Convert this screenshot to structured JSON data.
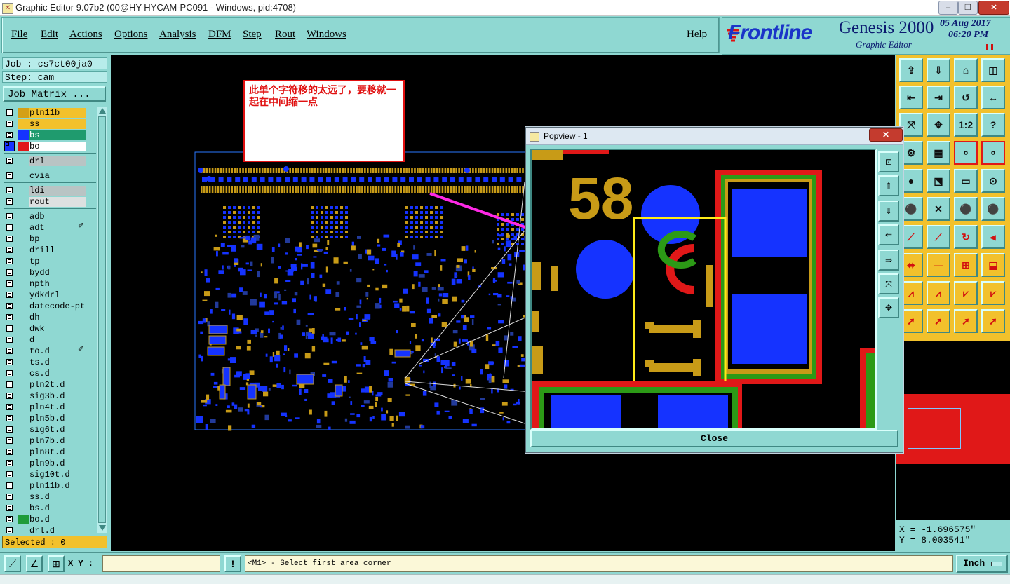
{
  "window": {
    "title": "Graphic Editor 9.07b2 (00@HY-HYCAM-PC091 - Windows, pid:4708)",
    "buttons": {
      "minimize": "–",
      "restore": "❐",
      "close": "✕"
    }
  },
  "menubar": {
    "items": [
      "File",
      "Edit",
      "Actions",
      "Options",
      "Analysis",
      "DFM",
      "Step",
      "Rout",
      "Windows"
    ],
    "help": "Help"
  },
  "logo": {
    "brand": "Frontline",
    "product": "Genesis 2000",
    "subtitle": "Graphic Editor",
    "date": "05 Aug 2017",
    "time": "06:20 PM"
  },
  "job": {
    "job_label": "Job : cs7ct00ja0",
    "step_label": "Step: cam",
    "matrix_button": "Job Matrix ..."
  },
  "layers": [
    {
      "name": "pln11b",
      "color": "#d4a017",
      "nameBg": "#f2c12c",
      "group": 0
    },
    {
      "name": "ss",
      "color": "#f2c12c",
      "nameBg": "#f2c12c",
      "group": 0
    },
    {
      "name": "bs",
      "color": "#1533ff",
      "nameBg": "#1f9b6e",
      "group": 0
    },
    {
      "name": "bo",
      "color": "#e01818",
      "nameBg": "#ffffff",
      "group": 0,
      "chkBlue": true
    },
    {
      "name": "drl",
      "color": "",
      "nameBg": "#b9c4c4",
      "group": 1
    },
    {
      "name": "cvia",
      "color": "",
      "nameBg": "#8fd8d2",
      "group": 2
    },
    {
      "name": "ldi",
      "color": "",
      "nameBg": "#b9c4c4",
      "group": 3
    },
    {
      "name": "rout",
      "color": "",
      "nameBg": "#dde0e0",
      "group": 3
    },
    {
      "name": "adb",
      "color": "",
      "nameBg": "#8fd8d2",
      "group": 4
    },
    {
      "name": "adt",
      "color": "",
      "nameBg": "#8fd8d2",
      "group": 4,
      "mark": true
    },
    {
      "name": "bp",
      "color": "",
      "nameBg": "#8fd8d2",
      "group": 4
    },
    {
      "name": "drill",
      "color": "",
      "nameBg": "#8fd8d2",
      "group": 4
    },
    {
      "name": "tp",
      "color": "",
      "nameBg": "#8fd8d2",
      "group": 4
    },
    {
      "name": "bydd",
      "color": "",
      "nameBg": "#8fd8d2",
      "group": 4
    },
    {
      "name": "npth",
      "color": "",
      "nameBg": "#8fd8d2",
      "group": 4
    },
    {
      "name": "ydkdrl",
      "color": "",
      "nameBg": "#8fd8d2",
      "group": 4
    },
    {
      "name": "datecode-ptd",
      "color": "",
      "nameBg": "#8fd8d2",
      "group": 4
    },
    {
      "name": "dh",
      "color": "",
      "nameBg": "#8fd8d2",
      "group": 4
    },
    {
      "name": "dwk",
      "color": "",
      "nameBg": "#8fd8d2",
      "group": 4
    },
    {
      "name": "d",
      "color": "",
      "nameBg": "#8fd8d2",
      "group": 4
    },
    {
      "name": "to.d",
      "color": "",
      "nameBg": "#8fd8d2",
      "group": 4,
      "mark": true
    },
    {
      "name": "ts.d",
      "color": "",
      "nameBg": "#8fd8d2",
      "group": 4
    },
    {
      "name": "cs.d",
      "color": "",
      "nameBg": "#8fd8d2",
      "group": 4
    },
    {
      "name": "pln2t.d",
      "color": "",
      "nameBg": "#8fd8d2",
      "group": 4
    },
    {
      "name": "sig3b.d",
      "color": "",
      "nameBg": "#8fd8d2",
      "group": 4
    },
    {
      "name": "pln4t.d",
      "color": "",
      "nameBg": "#8fd8d2",
      "group": 4
    },
    {
      "name": "pln5b.d",
      "color": "",
      "nameBg": "#8fd8d2",
      "group": 4
    },
    {
      "name": "sig6t.d",
      "color": "",
      "nameBg": "#8fd8d2",
      "group": 4
    },
    {
      "name": "pln7b.d",
      "color": "",
      "nameBg": "#8fd8d2",
      "group": 4
    },
    {
      "name": "pln8t.d",
      "color": "",
      "nameBg": "#8fd8d2",
      "group": 4
    },
    {
      "name": "pln9b.d",
      "color": "",
      "nameBg": "#8fd8d2",
      "group": 4
    },
    {
      "name": "sig10t.d",
      "color": "",
      "nameBg": "#8fd8d2",
      "group": 4
    },
    {
      "name": "pln11b.d",
      "color": "",
      "nameBg": "#8fd8d2",
      "group": 4
    },
    {
      "name": "ss.d",
      "color": "",
      "nameBg": "#8fd8d2",
      "group": 4
    },
    {
      "name": "bs.d",
      "color": "",
      "nameBg": "#8fd8d2",
      "group": 4
    },
    {
      "name": "bo.d",
      "color": "#1f9b3a",
      "nameBg": "#8fd8d2",
      "group": 4
    },
    {
      "name": "drl.d",
      "color": "",
      "nameBg": "#8fd8d2",
      "group": 4
    }
  ],
  "status": {
    "selected": "Selected : 0"
  },
  "annotation": {
    "text": "此单个字符移的太远了，要移就一起在中间缩一点"
  },
  "popview": {
    "title": "Popview - 1",
    "close_label": "Close",
    "silk_number": "58",
    "silk_label": "C11"
  },
  "coords": {
    "x": "X = -1.696575\"",
    "y": "Y = 8.003541\""
  },
  "bottom": {
    "xy_label": "X Y :",
    "xy_value": "",
    "exclaim": "!",
    "prompt": "<M1> - Select first area corner",
    "unit": "Inch"
  },
  "toolbar": {
    "buttons": [
      "home",
      "open",
      "step",
      "fit",
      "prev",
      "next",
      "fold",
      "flip",
      "zoom-area",
      "zoom-pan",
      "ratio-1-2",
      "help",
      "snap",
      "grid",
      "measure",
      "measure-alt",
      "dot-black",
      "net",
      "ruler",
      "point",
      "link-red",
      "cut",
      "link",
      "link-alt",
      "draw",
      "line",
      "rotate",
      "split",
      "break",
      "line-red",
      "window",
      "shape",
      "arc-up",
      "arc-up-alt",
      "arc-down",
      "arc-down-alt",
      "pointer",
      "pointer-box",
      "pointer-alt",
      "pointer-net"
    ]
  },
  "colors": {
    "panel": "#8fd8d2",
    "accent": "#f2c12c",
    "copper": "#1533ff",
    "silk": "#c89b17",
    "annotation": "#e01010"
  }
}
